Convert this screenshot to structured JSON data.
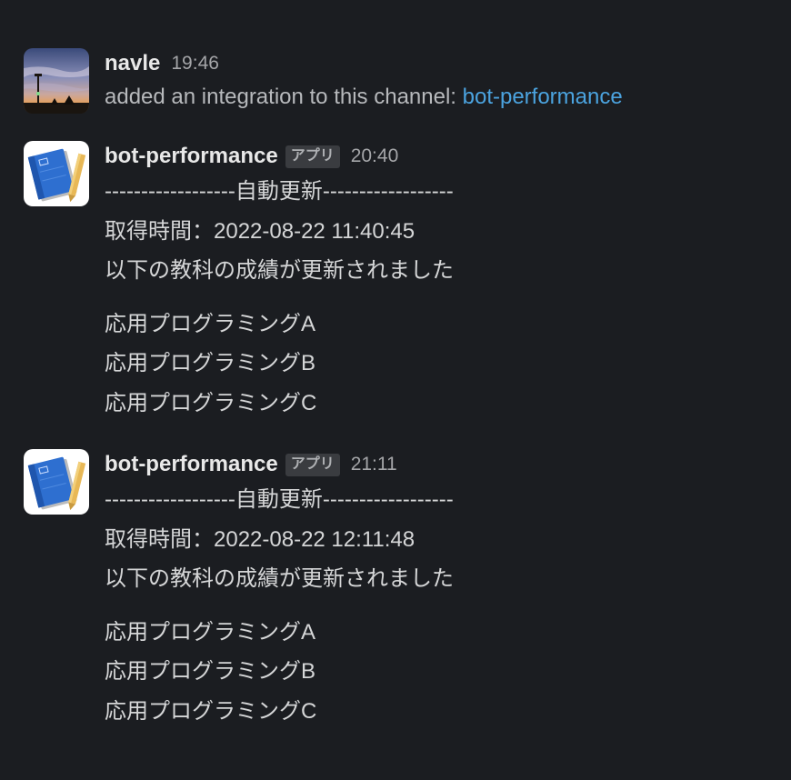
{
  "messages": [
    {
      "author": "navle",
      "time": "19:46",
      "text_prefix": "added an integration to this channel: ",
      "link_text": "bot-performance",
      "avatar_icon": "sunset-photo-avatar"
    },
    {
      "author": "bot-performance",
      "badge": "アプリ",
      "time": "20:40",
      "avatar_icon": "notebook-pencil-icon",
      "lines": [
        "------------------自動更新------------------",
        "取得時間：2022-08-22  11:40:45",
        "以下の教科の成績が更新されました"
      ],
      "subjects": [
        "応用プログラミングA",
        "応用プログラミングB",
        "応用プログラミングC"
      ]
    },
    {
      "author": "bot-performance",
      "badge": "アプリ",
      "time": "21:11",
      "avatar_icon": "notebook-pencil-icon",
      "lines": [
        "------------------自動更新------------------",
        "取得時間：2022-08-22  12:11:48",
        "以下の教科の成績が更新されました"
      ],
      "subjects": [
        "応用プログラミングA",
        "応用プログラミングB",
        "応用プログラミングC"
      ]
    }
  ],
  "colors": {
    "background": "#1b1d21",
    "link": "#4ba3df",
    "text": "#d1d2d3"
  }
}
